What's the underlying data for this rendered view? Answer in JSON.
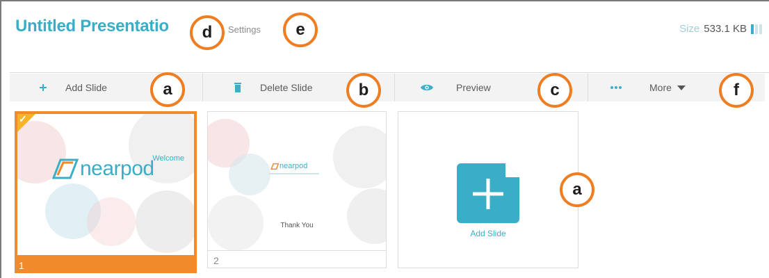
{
  "header": {
    "title": "Untitled Presentatio",
    "settings_label": "Settings",
    "size_label": "Size",
    "size_value": "533.1 KB"
  },
  "toolbar": {
    "add_label": "Add Slide",
    "delete_label": "Delete Slide",
    "preview_label": "Preview",
    "more_label": "More"
  },
  "slides": [
    {
      "number": "1",
      "welcome": "Welcome",
      "logo": "nearpod",
      "selected": true
    },
    {
      "number": "2",
      "logo": "nearpod",
      "caption": "Thank You"
    }
  ],
  "add_tile": {
    "label": "Add Slide"
  },
  "callouts": {
    "a1": "a",
    "b": "b",
    "c": "c",
    "d": "d",
    "e": "e",
    "f": "f",
    "a2": "a"
  },
  "colors": {
    "accent": "#3aaec7",
    "orange": "#f18a2a",
    "callout_ring": "#ef7d22"
  }
}
